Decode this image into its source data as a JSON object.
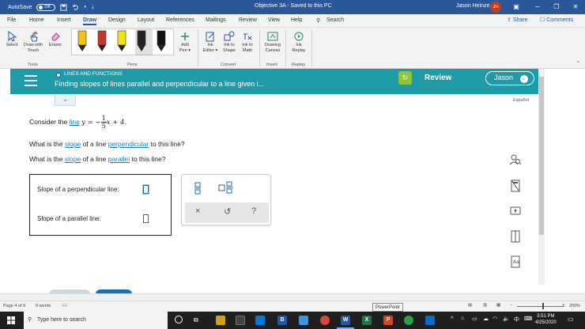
{
  "window": {
    "autosave_label": "AutoSave",
    "autosave_state": "Off",
    "title": "Objective 3A  -  Saved to this PC",
    "user_name": "Jason Heinze",
    "user_initials": "JH"
  },
  "ribbon_tabs": [
    "File",
    "Home",
    "Insert",
    "Draw",
    "Design",
    "Layout",
    "References",
    "Mailings",
    "Review",
    "View",
    "Help"
  ],
  "active_tab": "Draw",
  "search_label": "Search",
  "share_label": "Share",
  "comments_label": "Comments",
  "ribbon": {
    "tools": {
      "select": "Select",
      "draw_touch_1": "Draw with",
      "draw_touch_2": "Touch",
      "eraser": "Eraser",
      "group": "Tools"
    },
    "pens_group": "Pens",
    "pen_colors": [
      "#f1c40f",
      "#c0392b",
      "#f5e50a",
      "#222222",
      "#111111"
    ],
    "add_pen_1": "Add",
    "add_pen_2": "Pen",
    "convert": {
      "ink_editor_1": "Ink",
      "ink_editor_2": "Editor",
      "ink_shape_1": "Ink to",
      "ink_shape_2": "Shape",
      "ink_math_1": "Ink to",
      "ink_math_2": "Math",
      "group": "Convert"
    },
    "insert": {
      "drawing_canvas_1": "Drawing",
      "drawing_canvas_2": "Canvas",
      "group": "Insert"
    },
    "replay": {
      "ink_replay_1": "Ink",
      "ink_replay_2": "Replay",
      "group": "Replay"
    }
  },
  "aleks": {
    "topic_category": "LINES AND FUNCTIONS",
    "topic_title": "Finding slopes of lines parallel and perpendicular to a line given i...",
    "review_label": "Review",
    "user_button": "Jason",
    "espanol": "Español",
    "question": {
      "consider_prefix": "Consider the ",
      "line_link": "line",
      "eq_lhs": "y = −",
      "eq_num": "1",
      "eq_den": "5",
      "eq_rhs": "x + 4.",
      "q1_prefix": "What is the ",
      "q1_slope": "slope",
      "q1_mid": " of a line ",
      "q1_link": "perpendicular",
      "q1_suffix": " to this line?",
      "q2_prefix": "What is the ",
      "q2_slope": "slope",
      "q2_mid": " of a line ",
      "q2_link": "parallel",
      "q2_suffix": " to this line?"
    },
    "answers": {
      "perpendicular_label": "Slope of a perpendicular line:",
      "parallel_label": "Slope of a parallel line:"
    },
    "keypad": {
      "clear": "×",
      "undo": "↺",
      "help": "?"
    },
    "side_tools": [
      "person-search-icon",
      "calculator-icon",
      "video-icon",
      "textbook-icon",
      "dictionary-icon"
    ],
    "accent_color": "#1e9aa9",
    "review_color": "#8cc63f"
  },
  "statusbar": {
    "page": "Page 4 of 9",
    "words": "0 words",
    "zoom": "200%",
    "tooltip": "PowerPoint"
  },
  "taskbar": {
    "search_placeholder": "Type here to search",
    "time": "3:51 PM",
    "date": "4/25/2020"
  }
}
